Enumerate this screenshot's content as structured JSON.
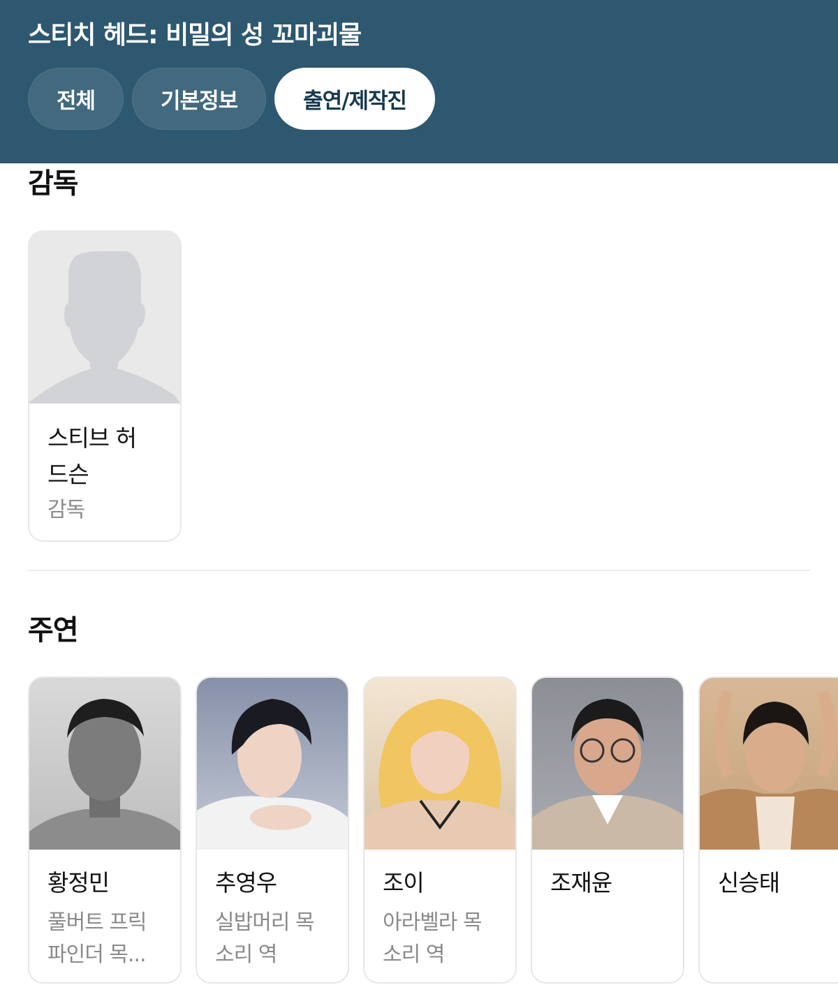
{
  "header": {
    "title": "스티치 헤드: 비밀의 성 꼬마괴물",
    "tabs": [
      {
        "label": "전체",
        "active": false
      },
      {
        "label": "기본정보",
        "active": false
      },
      {
        "label": "출연/제작진",
        "active": true
      }
    ],
    "background_color": "#2d5870"
  },
  "sections": {
    "director": {
      "title": "감독",
      "people": [
        {
          "name": "스티브 허",
          "name2": "드슨",
          "role": "감독",
          "photo": "default-avatar-icon"
        }
      ]
    },
    "cast": {
      "title": "주연",
      "people": [
        {
          "name": "황정민",
          "role1": "풀버트 프릭",
          "role2": "파인더 목..."
        },
        {
          "name": "추영우",
          "role1": "실밥머리 목",
          "role2": "소리 역"
        },
        {
          "name": "조이",
          "role1": "아라벨라 목",
          "role2": "소리 역"
        },
        {
          "name": "조재윤",
          "role1": "",
          "role2": ""
        },
        {
          "name": "신승태",
          "role1": "",
          "role2": ""
        }
      ]
    }
  }
}
